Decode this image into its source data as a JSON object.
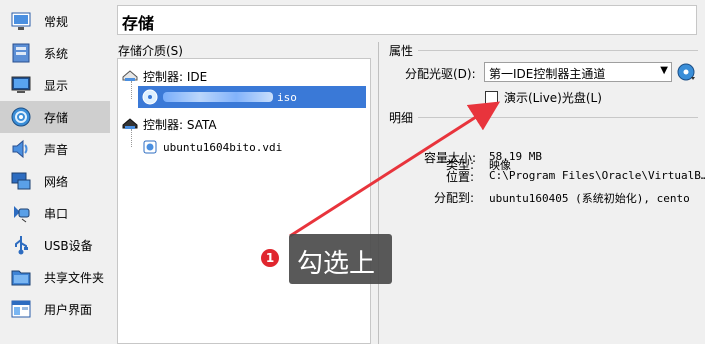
{
  "sidebar": {
    "items": [
      {
        "label": "常规",
        "icon": "general-icon"
      },
      {
        "label": "系统",
        "icon": "system-icon"
      },
      {
        "label": "显示",
        "icon": "display-icon"
      },
      {
        "label": "存储",
        "icon": "storage-icon",
        "active": true
      },
      {
        "label": "声音",
        "icon": "audio-icon"
      },
      {
        "label": "网络",
        "icon": "network-icon"
      },
      {
        "label": "串口",
        "icon": "serial-port-icon"
      },
      {
        "label": "USB设备",
        "icon": "usb-icon"
      },
      {
        "label": "共享文件夹",
        "icon": "shared-folder-icon"
      },
      {
        "label": "用户界面",
        "icon": "user-interface-icon"
      }
    ]
  },
  "header": {
    "title": "存储"
  },
  "storage_tree": {
    "caption": "存储介质(S)",
    "controllers": [
      {
        "label": "控制器: IDE",
        "devices": [
          {
            "label": "iso",
            "selected": true,
            "type": "optical"
          }
        ]
      },
      {
        "label": "控制器: SATA",
        "devices": [
          {
            "label": "ubuntu1604bito.vdi",
            "selected": false,
            "type": "hard-disk"
          }
        ]
      }
    ]
  },
  "attributes": {
    "section_title": "属性",
    "optical_drive_label": "分配光驱(D):",
    "optical_drive_value": "第一IDE控制器主通道",
    "live_cd_label": "演示(Live)光盘(L)",
    "live_cd_checked": false
  },
  "details": {
    "section_title": "明细",
    "rows": [
      {
        "label": "类型:",
        "value": "映像"
      },
      {
        "label": "容量大小:",
        "value": "58.19  MB"
      },
      {
        "label": "位置:",
        "value": "C:\\Program  Files\\Oracle\\VirtualB…"
      },
      {
        "label": "分配到:",
        "value": "ubuntu160405  (系统初始化),  cento"
      }
    ]
  },
  "annotation": {
    "badge": "1",
    "callout": "勾选上",
    "arrow_color": "#e8343c"
  }
}
